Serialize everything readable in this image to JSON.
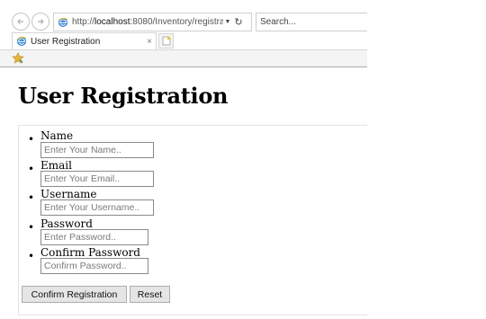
{
  "browser": {
    "address_prefix": "http://",
    "address_host": "localhost",
    "address_rest": ":8080/Inventory/registra",
    "search_placeholder": "Search...",
    "tab_title": "User Registration",
    "tab_close": "×",
    "refresh_glyph": "↻",
    "dropdown_glyph": "▼"
  },
  "page": {
    "title": "User Registration"
  },
  "form": {
    "bullet": "•",
    "fields": [
      {
        "label": "Name",
        "placeholder": "Enter Your Name..",
        "value": ""
      },
      {
        "label": "Email",
        "placeholder": "Enter Your Email..",
        "value": ""
      },
      {
        "label": "Username",
        "placeholder": "Enter Your Username..",
        "value": ""
      },
      {
        "label": "Password",
        "placeholder": "Enter Password..",
        "value": ""
      },
      {
        "label": "Confirm Password",
        "placeholder": "Confirm Password..",
        "value": ""
      }
    ],
    "submit_label": "Confirm Registration",
    "reset_label": "Reset"
  },
  "colors": {
    "ie_icon_blue": "#2a7fd4",
    "favorites_star": "#e8b53a"
  }
}
